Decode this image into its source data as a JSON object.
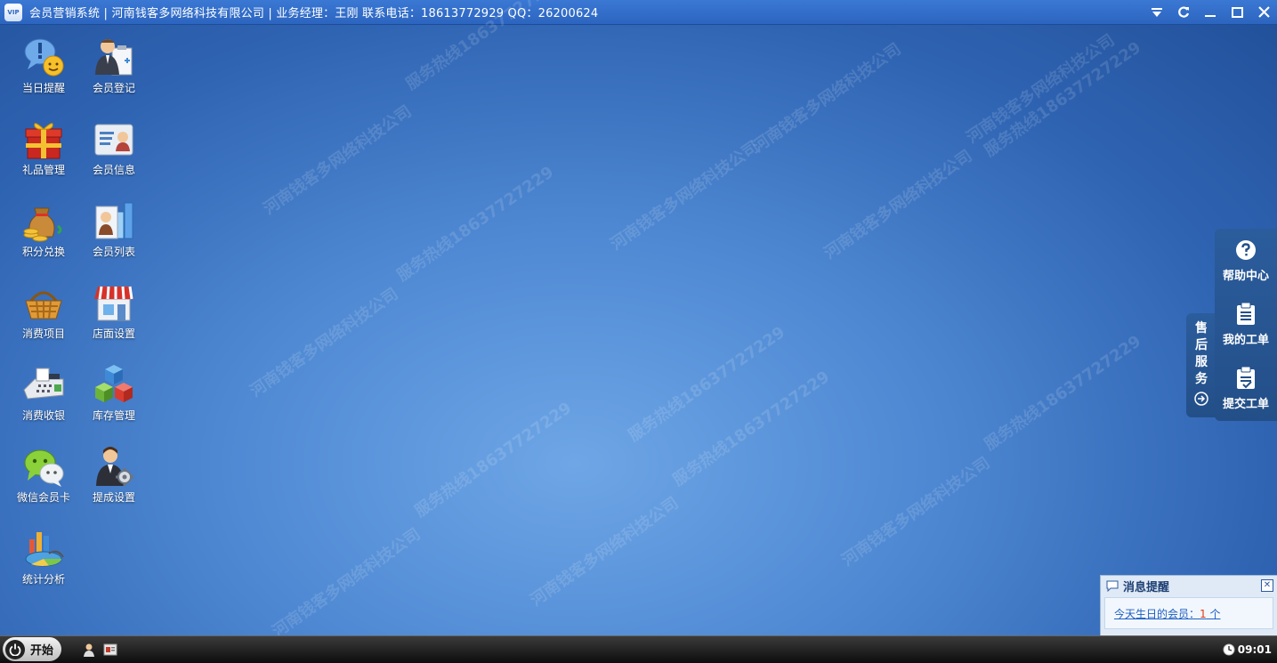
{
  "window": {
    "logo_text": "VIP",
    "title": "会员营销系统 | 河南钱客多网络科技有限公司 | 业务经理：王刚 联系电话：18613772929 QQ：26200624"
  },
  "watermark": {
    "company": "河南钱客多网络科技公司",
    "hotline": "服务热线18637727229"
  },
  "desktop_icons": [
    {
      "label": "当日提醒",
      "icon": "reminder-bubble-icon"
    },
    {
      "label": "会员登记",
      "icon": "member-register-icon"
    },
    {
      "label": "礼品管理",
      "icon": "gift-icon"
    },
    {
      "label": "会员信息",
      "icon": "member-card-icon"
    },
    {
      "label": "积分兑换",
      "icon": "money-bag-icon"
    },
    {
      "label": "会员列表",
      "icon": "member-chart-icon"
    },
    {
      "label": "消费项目",
      "icon": "basket-icon"
    },
    {
      "label": "店面设置",
      "icon": "storefront-icon"
    },
    {
      "label": "消费收银",
      "icon": "cash-register-icon"
    },
    {
      "label": "库存管理",
      "icon": "cubes-icon"
    },
    {
      "label": "微信会员卡",
      "icon": "wechat-icon"
    },
    {
      "label": "提成设置",
      "icon": "commission-settings-icon"
    },
    {
      "label": "统计分析",
      "icon": "statistics-icon"
    }
  ],
  "service": {
    "tab_chars": [
      "售",
      "后",
      "服",
      "务"
    ],
    "items": [
      {
        "label": "帮助中心",
        "icon": "help-icon"
      },
      {
        "label": "我的工单",
        "icon": "clipboard-icon"
      },
      {
        "label": "提交工单",
        "icon": "submit-clipboard-icon"
      }
    ]
  },
  "message": {
    "title": "消息提醒",
    "text": "今天生日的会员：",
    "count": "1",
    "unit": "个"
  },
  "taskbar": {
    "start_label": "开始",
    "time": "09:01"
  },
  "colors": {
    "titlebar": "#2c65c0",
    "desktop": "#3e78c6",
    "count_red": "#e03a1a"
  }
}
